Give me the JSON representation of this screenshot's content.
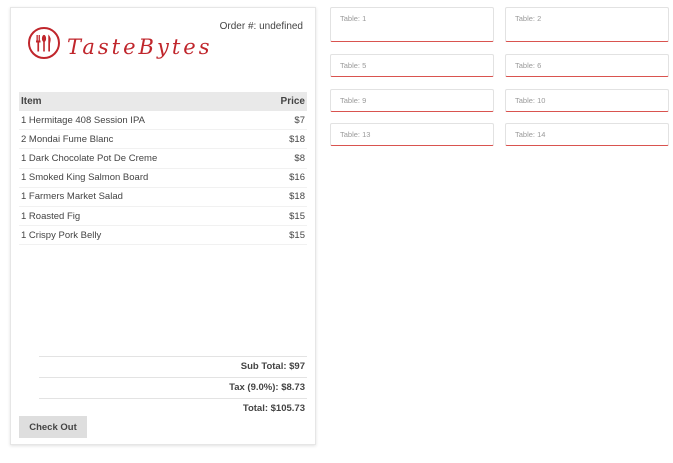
{
  "receipt": {
    "brand": "TasteBytes",
    "order_label": "Order #: undefined",
    "columns": {
      "item": "Item",
      "price": "Price"
    },
    "items": [
      {
        "name": "1 Hermitage 408 Session IPA",
        "price": "$7"
      },
      {
        "name": "2 Mondai Fume Blanc",
        "price": "$18"
      },
      {
        "name": "1 Dark Chocolate Pot De Creme",
        "price": "$8"
      },
      {
        "name": "1 Smoked King Salmon Board",
        "price": "$16"
      },
      {
        "name": "1 Farmers Market Salad",
        "price": "$18"
      },
      {
        "name": "1 Roasted Fig",
        "price": "$15"
      },
      {
        "name": "1 Crispy Pork Belly",
        "price": "$15"
      }
    ],
    "subtotal": "Sub Total: $97",
    "tax": "Tax (9.0%): $8.73",
    "total": "Total: $105.73",
    "checkout_label": "Check Out"
  },
  "tables": [
    {
      "label": "Table: 1"
    },
    {
      "label": "Table: 2"
    },
    {
      "label": "Table: 5"
    },
    {
      "label": "Table: 6"
    },
    {
      "label": "Table: 9"
    },
    {
      "label": "Table: 10"
    },
    {
      "label": "Table: 13"
    },
    {
      "label": "Table: 14"
    }
  ],
  "colors": {
    "accent": "#c0262c",
    "card_border": "#d9534f"
  },
  "icons": {
    "logo": "utensils-in-circle-icon"
  }
}
